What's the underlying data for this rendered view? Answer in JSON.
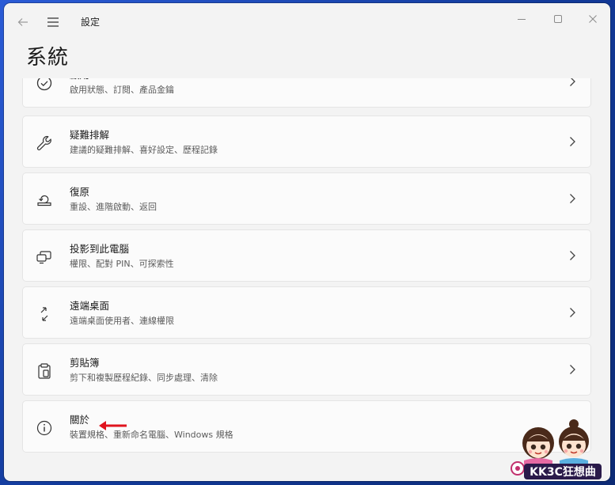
{
  "app": {
    "title": "設定"
  },
  "page": {
    "title": "系統"
  },
  "items": [
    {
      "title": "啟用",
      "subtitle": "啟用狀態、訂閱、產品金鑰",
      "icon": "check-circle-icon"
    },
    {
      "title": "疑難排解",
      "subtitle": "建議的疑難排解、喜好設定、歷程記錄",
      "icon": "wrench-icon"
    },
    {
      "title": "復原",
      "subtitle": "重設、進階啟動、返回",
      "icon": "recovery-icon"
    },
    {
      "title": "投影到此電腦",
      "subtitle": "權限、配對 PIN、可探索性",
      "icon": "project-icon"
    },
    {
      "title": "遠端桌面",
      "subtitle": "遠端桌面使用者、連線權限",
      "icon": "remote-desktop-icon"
    },
    {
      "title": "剪貼簿",
      "subtitle": "剪下和複製歷程紀錄、同步處理、清除",
      "icon": "clipboard-icon"
    },
    {
      "title": "關於",
      "subtitle": "裝置規格、重新命名電腦、Windows 規格",
      "icon": "info-icon"
    }
  ],
  "annotation": {
    "color": "#e0141e"
  },
  "watermark": {
    "text": "KK3C狂想曲"
  }
}
